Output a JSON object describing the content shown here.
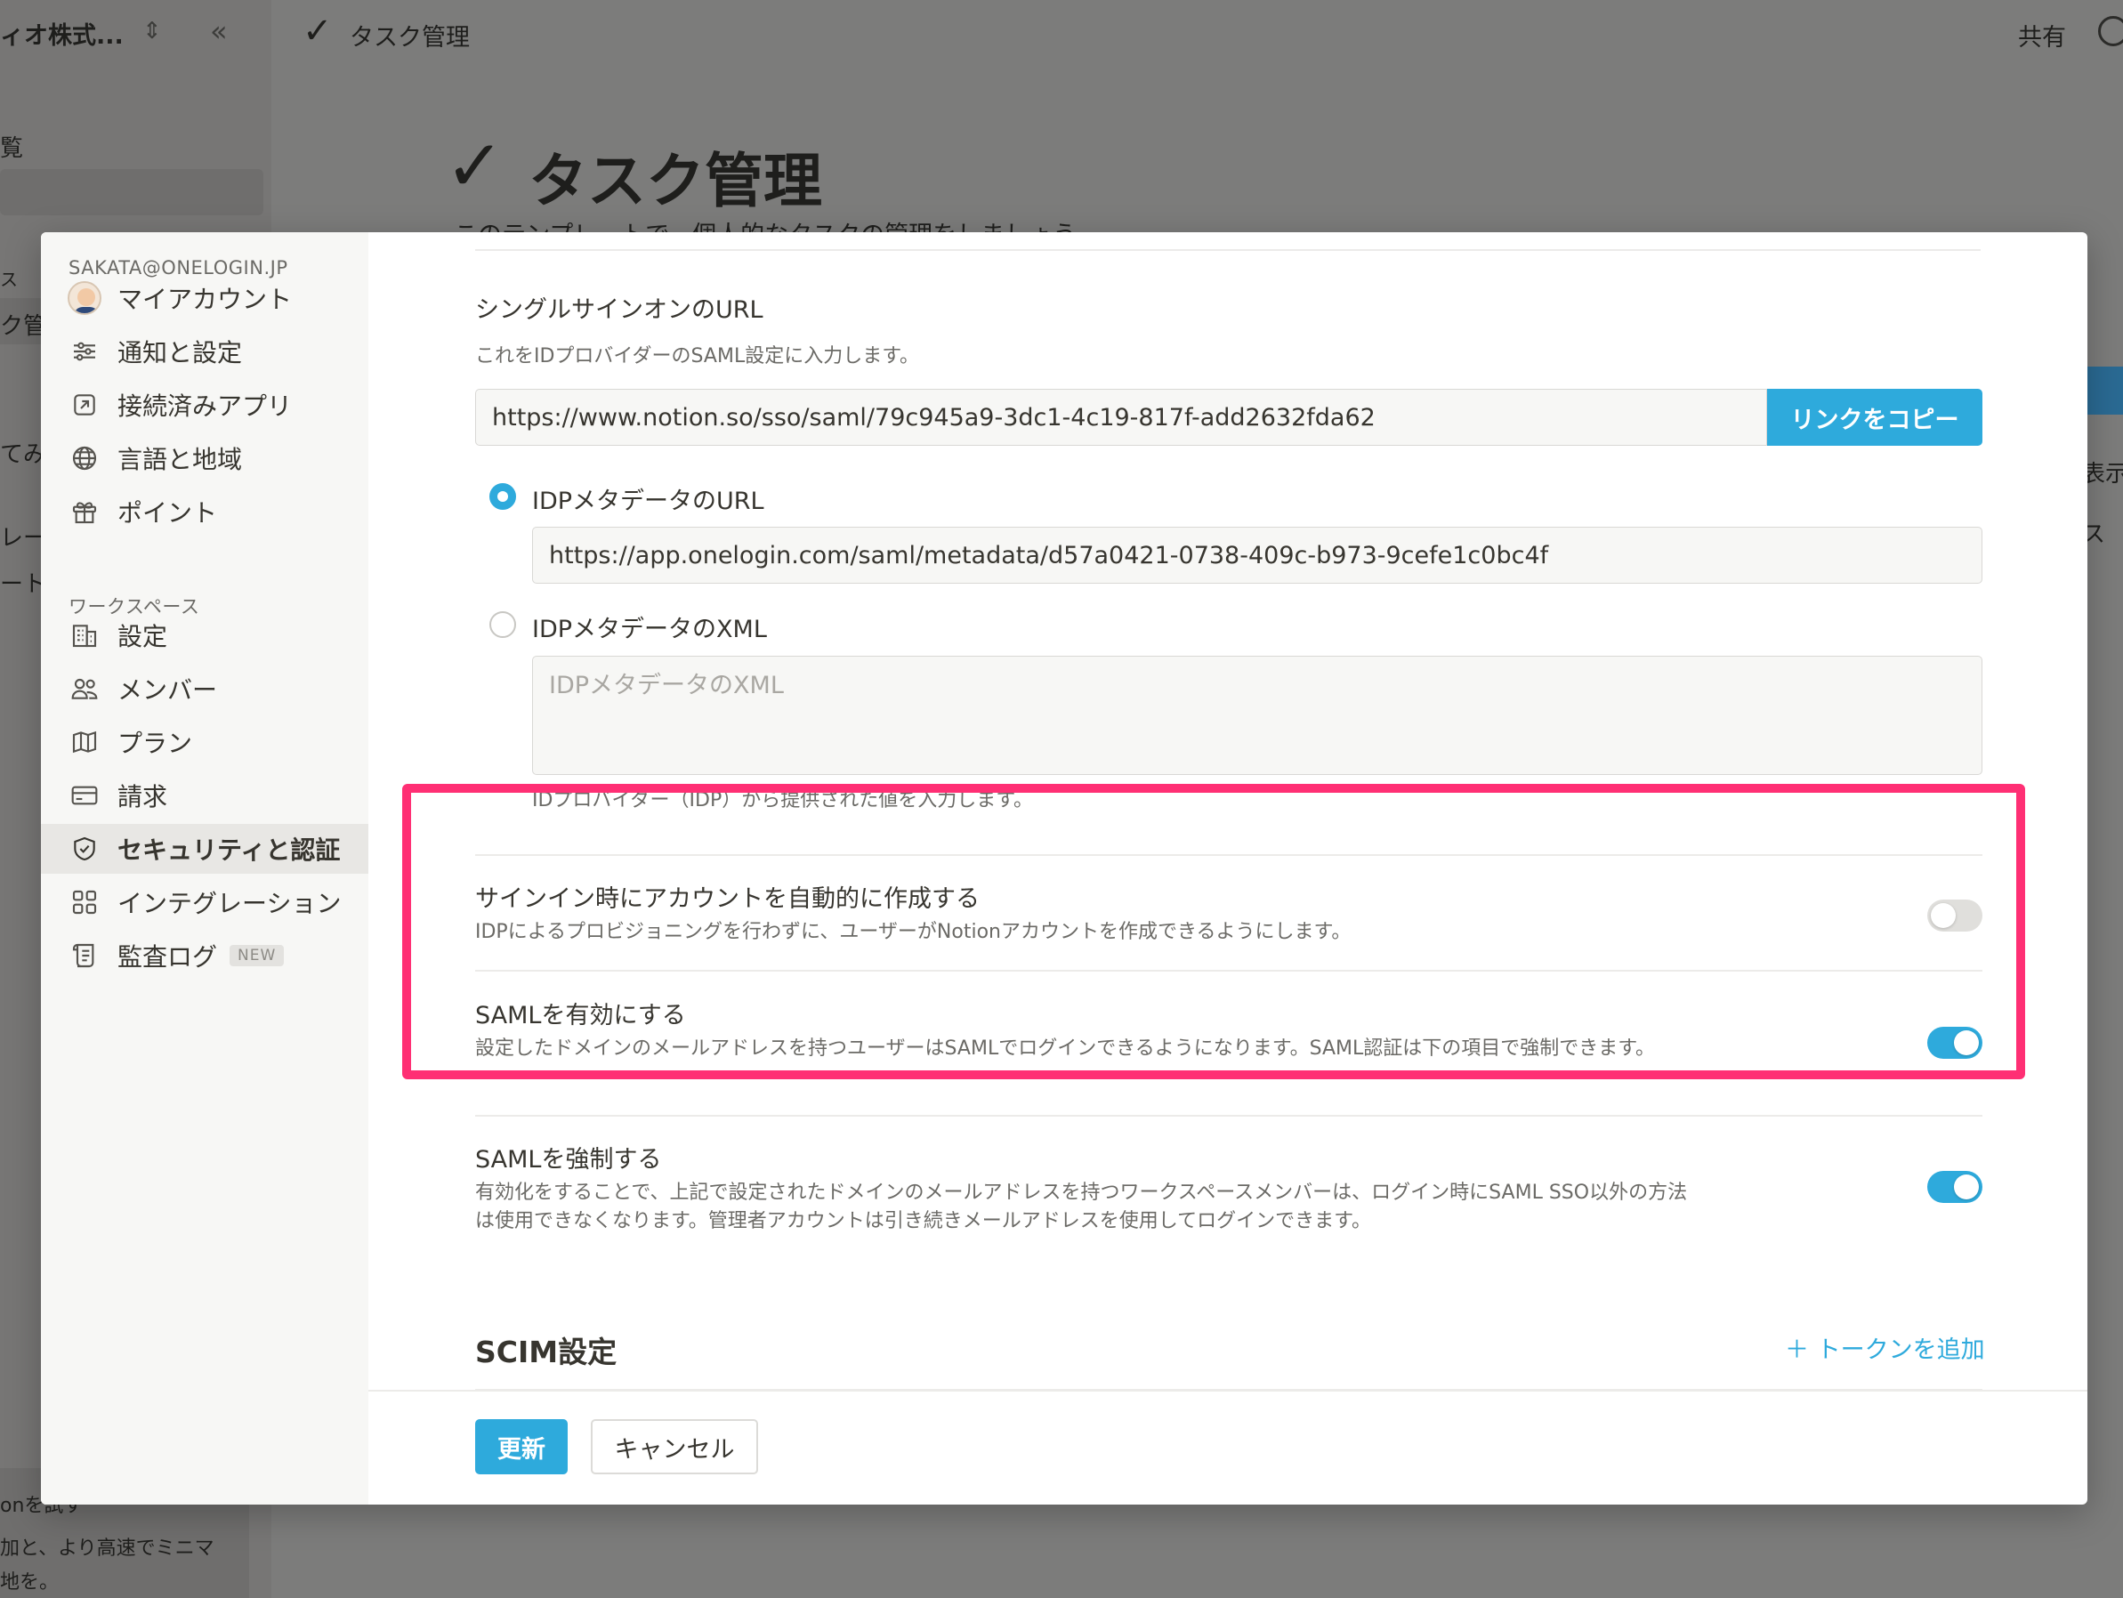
{
  "background": {
    "workspace_name": "ィオ株式...",
    "sidebar_fragments": [
      "覧",
      "ス",
      "ク管",
      "てみ",
      "レー",
      "ート"
    ],
    "trial_lines": [
      "onを試す",
      "加と、より高速でミニマ",
      "地を。"
    ],
    "topbar_title": "タスク管理",
    "share_label": "共有",
    "page_title": "タスク管理",
    "page_subtitle": "このテンプレートで、個人的なタスクの管理をしましょう",
    "right_fragments": [
      "表示",
      "ス"
    ]
  },
  "sidebar": {
    "account_email": "SAKATA@ONELOGIN.JP",
    "account_items": [
      {
        "label": "マイアカウント",
        "icon": "avatar"
      },
      {
        "label": "通知と設定",
        "icon": "sliders-icon"
      },
      {
        "label": "接続済みアプリ",
        "icon": "external-link-icon"
      },
      {
        "label": "言語と地域",
        "icon": "globe-icon"
      },
      {
        "label": "ポイント",
        "icon": "gift-icon"
      }
    ],
    "workspace_label": "ワークスペース",
    "workspace_items": [
      {
        "label": "設定",
        "icon": "building-icon"
      },
      {
        "label": "メンバー",
        "icon": "people-icon"
      },
      {
        "label": "プラン",
        "icon": "map-icon"
      },
      {
        "label": "請求",
        "icon": "credit-card-icon"
      },
      {
        "label": "セキュリティと認証",
        "icon": "shield-check-icon",
        "active": true
      },
      {
        "label": "インテグレーション",
        "icon": "grid-icon"
      },
      {
        "label": "監査ログ",
        "icon": "scroll-icon",
        "badge": "NEW"
      }
    ]
  },
  "sso": {
    "title": "シングルサインオンのURL",
    "desc": "これをIDプロバイダーのSAML設定に入力します。",
    "url": "https://www.notion.so/sso/saml/79c945a9-3dc1-4c19-817f-add2632fda62",
    "copy_label": "リンクをコピー"
  },
  "idp": {
    "url_option_label": "IDPメタデータのURL",
    "url_value": "https://app.onelogin.com/saml/metadata/d57a0421-0738-409c-b973-9cefe1c0bc4f",
    "xml_option_label": "IDPメタデータのXML",
    "xml_placeholder": "IDPメタデータのXML",
    "hint": "IDプロバイダー（IDP）から提供された値を入力します。",
    "selected": "url"
  },
  "settings": [
    {
      "title": "サインイン時にアカウントを自動的に作成する",
      "desc": "IDPによるプロビジョニングを行わずに、ユーザーがNotionアカウントを作成できるようにします。",
      "enabled": false
    },
    {
      "title": "SAMLを有効にする",
      "desc": "設定したドメインのメールアドレスを持つユーザーはSAMLでログインできるようになります。SAML認証は下の項目で強制できます。",
      "enabled": true
    },
    {
      "title": "SAMLを強制する",
      "desc": "有効化をすることで、上記で設定されたドメインのメールアドレスを持つワークスペースメンバーは、ログイン時にSAML SSO以外の方法は使用できなくなります。管理者アカウントは引き続きメールアドレスを使用してログインできます。",
      "enabled": true
    }
  ],
  "scim": {
    "title": "SCIM設定",
    "add_token_label": "トークンを追加"
  },
  "footer": {
    "update_label": "更新",
    "cancel_label": "キャンセル"
  },
  "colors": {
    "accent": "#2eaadc",
    "highlight": "#ff2f74"
  }
}
